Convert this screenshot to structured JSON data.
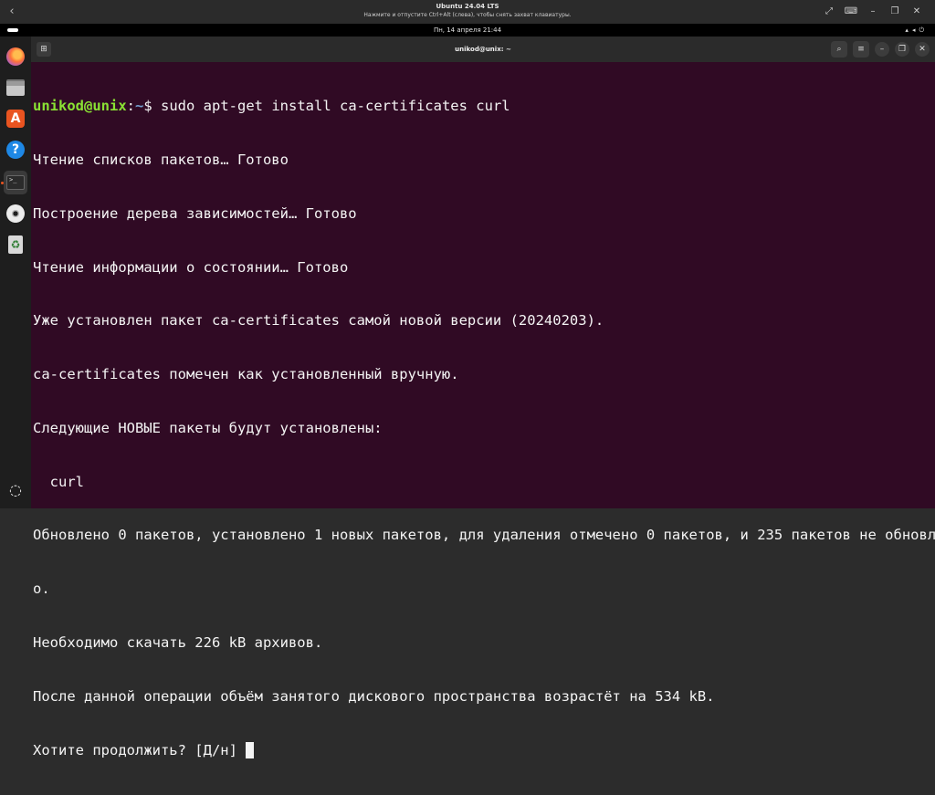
{
  "vm": {
    "title": "Ubuntu 24.04 LTS",
    "hint": "Нажмите и отпустите Ctrl+Alt (слева), чтобы снять захват клавиатуры.",
    "back_icon": "chevron-left-icon",
    "controls": [
      "fullscreen-icon",
      "keyboard-icon",
      "minimize-icon",
      "restore-icon",
      "close-icon"
    ]
  },
  "topbar": {
    "clock": "Пн, 14 апреля  21:44",
    "system_icons": [
      "network-icon",
      "volume-icon",
      "power-icon"
    ]
  },
  "dock": {
    "items": [
      {
        "name": "firefox",
        "icon": "firefox-icon"
      },
      {
        "name": "files",
        "icon": "folder-icon"
      },
      {
        "name": "app-center",
        "icon": "app-center-icon"
      },
      {
        "name": "help",
        "icon": "help-icon"
      },
      {
        "name": "terminal",
        "icon": "terminal-icon",
        "active": true
      },
      {
        "name": "disc",
        "icon": "optical-disc-icon"
      },
      {
        "name": "trash",
        "icon": "trash-icon"
      }
    ],
    "apps_icon": "show-apps-icon"
  },
  "terminal": {
    "title": "unikod@unix: ~",
    "prompt_user": "unikod@unix",
    "prompt_sep": ":",
    "prompt_path": "~",
    "prompt_symbol": "$",
    "command": " sudo apt-get install ca-certificates curl",
    "lines": [
      "Чтение списков пакетов… Готово",
      "Построение дерева зависимостей… Готово",
      "Чтение информации о состоянии… Готово",
      "Уже установлен пакет ca-certificates самой новой версии (20240203).",
      "ca-certificates помечен как установленный вручную.",
      "Следующие НОВЫЕ пакеты будут установлены:",
      "  curl",
      "Обновлено 0 пакетов, установлено 1 новых пакетов, для удаления отмечено 0 пакетов, и 235 пакетов не обновлен",
      "о.",
      "Необходимо скачать 226 kB архивов.",
      "После данной операции объём занятого дискового пространства возрастёт на 534 kB."
    ],
    "question": "Хотите продолжить? [Д/н] "
  },
  "colors": {
    "terminal_bg": "#300a24",
    "prompt_user": "#8ae234",
    "prompt_path": "#729fcf",
    "text": "#f4f4f4"
  }
}
